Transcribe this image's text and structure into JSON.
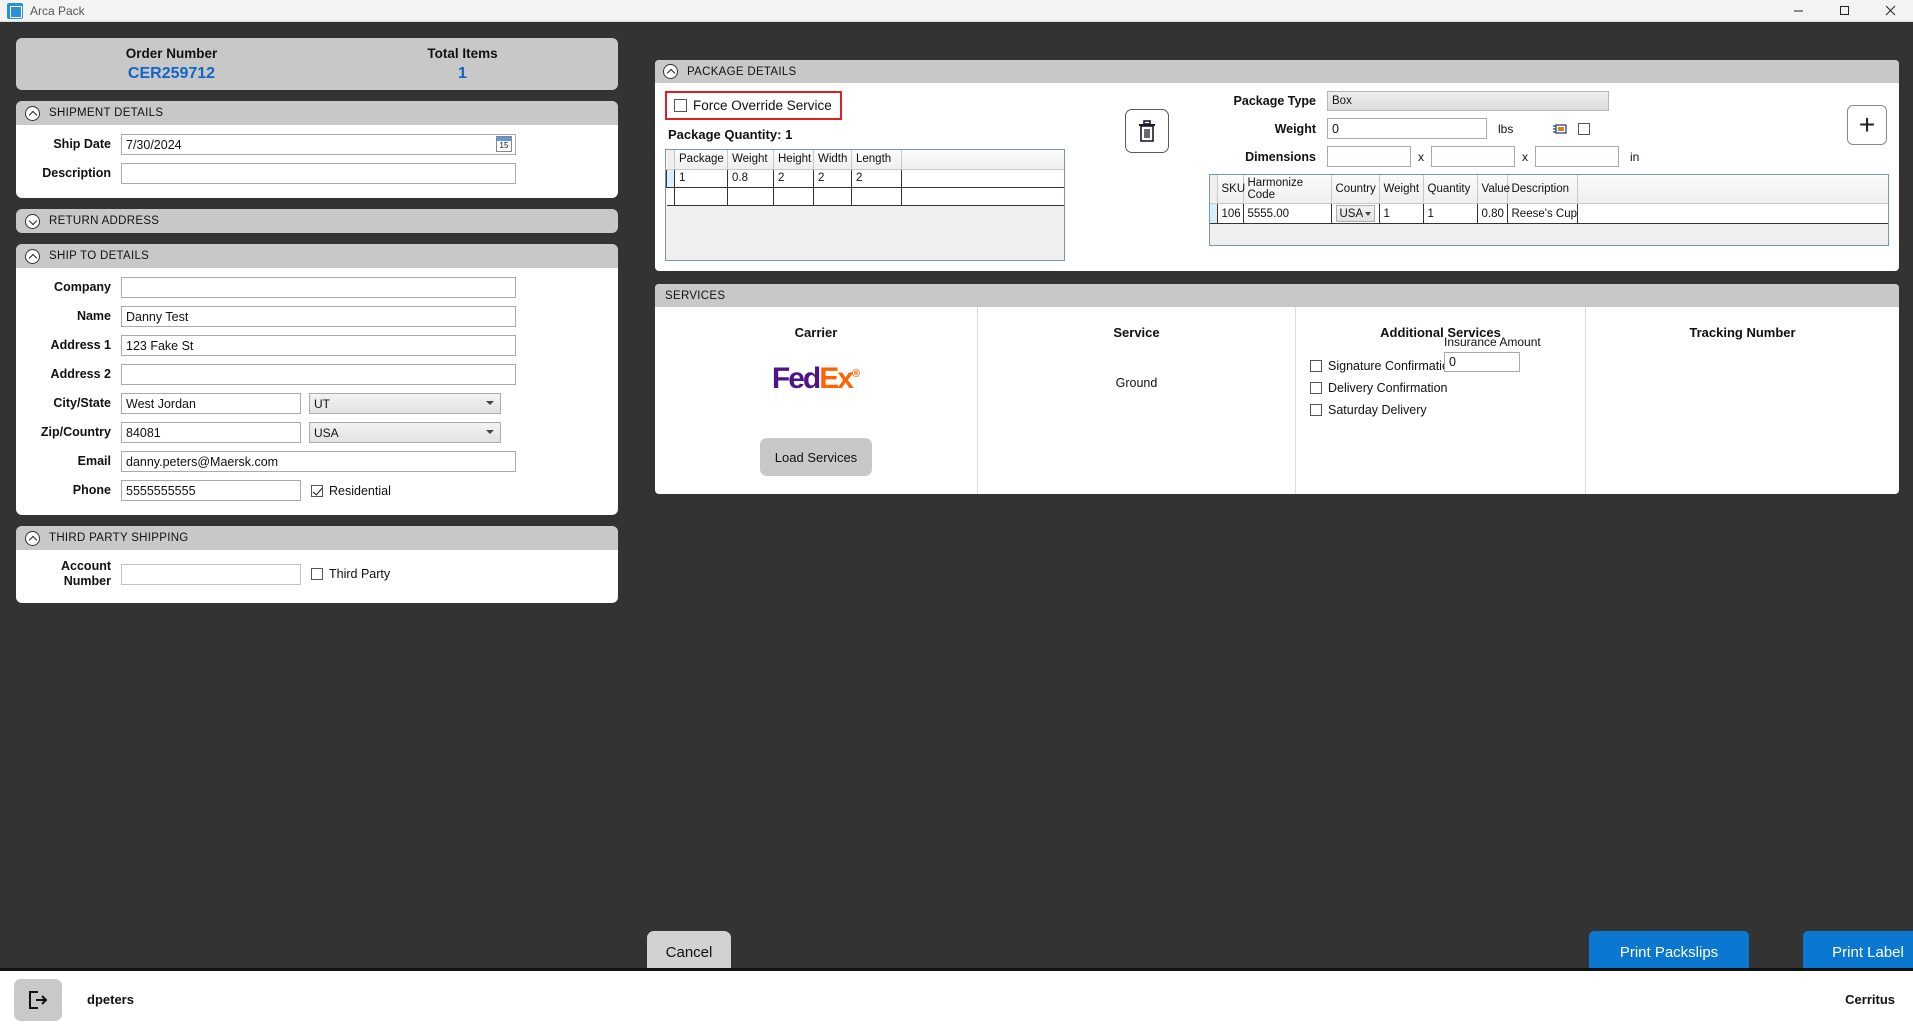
{
  "window": {
    "title": "Arca Pack",
    "icon": "app-icon",
    "minimize": "minimize-icon",
    "maximize": "maximize-icon",
    "close": "close-icon"
  },
  "order_header": {
    "order_number_label": "Order Number",
    "order_number_value": "CER259712",
    "total_items_label": "Total Items",
    "total_items_value": "1",
    "accent_color": "#0f66c6"
  },
  "shipment_details": {
    "title": "SHIPMENT DETAILS",
    "expanded": true,
    "ship_date_label": "Ship Date",
    "ship_date_value": "7/30/2024",
    "calendar_day": "15",
    "description_label": "Description",
    "description_value": ""
  },
  "return_address": {
    "title": "RETURN ADDRESS",
    "expanded": false
  },
  "ship_to_details": {
    "title": "SHIP TO DETAILS",
    "expanded": true,
    "company_label": "Company",
    "company_value": "",
    "name_label": "Name",
    "name_value": "Danny Test",
    "address1_label": "Address 1",
    "address1_value": "123 Fake St",
    "address2_label": "Address 2",
    "address2_value": "",
    "city_state_label": "City/State",
    "city_value": "West Jordan",
    "state_value": "UT",
    "zip_country_label": "Zip/Country",
    "zip_value": "84081",
    "country_value": "USA",
    "email_label": "Email",
    "email_value": "danny.peters@Maersk.com",
    "phone_label": "Phone",
    "phone_value": "5555555555",
    "residential_label": "Residential",
    "residential_checked": true
  },
  "third_party_shipping": {
    "title": "THIRD PARTY SHIPPING",
    "expanded": true,
    "account_number_label_line1": "Account",
    "account_number_label_line2": "Number",
    "account_number_value": "",
    "third_party_label": "Third Party",
    "third_party_checked": false
  },
  "package_details": {
    "title": "PACKAGE DETAILS",
    "expanded": true,
    "force_override_label": "Force Override Service",
    "force_override_checked": false,
    "force_override_highlight_color": "#e02020",
    "package_quantity_label": "Package Quantity:",
    "package_quantity_value": "1",
    "delete_icon": "trash-icon",
    "add_icon": "plus-icon",
    "packages_table": {
      "columns": [
        "Package",
        "Weight",
        "Height",
        "Width",
        "Length"
      ],
      "rows": [
        [
          "1",
          "0.8",
          "2",
          "2",
          "2"
        ]
      ]
    },
    "package_type_label": "Package Type",
    "package_type_value": "Box",
    "weight_label": "Weight",
    "weight_value": "0",
    "weight_unit": "lbs",
    "scale_icon": "scale-icon",
    "scale_checkbox_checked": false,
    "dimensions_label": "Dimensions",
    "dimension_1": "",
    "dimension_2": "",
    "dimension_3": "",
    "dimensions_separator": "x",
    "dimensions_unit": "in",
    "items_table": {
      "columns": [
        "SKU",
        "Harmonize Code",
        "Country",
        "Weight",
        "Quantity",
        "Value",
        "Description"
      ],
      "rows": [
        {
          "sku": "106",
          "harmonize_code": "5555.00",
          "country": "USA",
          "weight": "1",
          "quantity": "1",
          "value": "0.80",
          "description": "Reese's Cups"
        }
      ]
    }
  },
  "services": {
    "title": "SERVICES",
    "carrier_header": "Carrier",
    "carrier_logo_part1": "Fed",
    "carrier_logo_part2": "Ex",
    "carrier_logo_mark": "®",
    "load_services_label": "Load Services",
    "service_header": "Service",
    "service_value": "Ground",
    "additional_services_header": "Additional Services",
    "additional_services": [
      {
        "label": "Signature Confirmation",
        "checked": false
      },
      {
        "label": "Delivery Confirmation",
        "checked": false
      },
      {
        "label": "Saturday Delivery",
        "checked": false
      }
    ],
    "insurance_label": "Insurance Amount",
    "insurance_value": "0",
    "tracking_header": "Tracking Number",
    "tracking_value": ""
  },
  "footer": {
    "cancel_label": "Cancel",
    "print_packslips_label": "Print Packslips",
    "print_label_label": "Print Label",
    "primary_color": "#0a78d1"
  },
  "statusbar": {
    "logout_icon": "logout-icon",
    "user": "dpeters",
    "brand": "Cerritus"
  }
}
